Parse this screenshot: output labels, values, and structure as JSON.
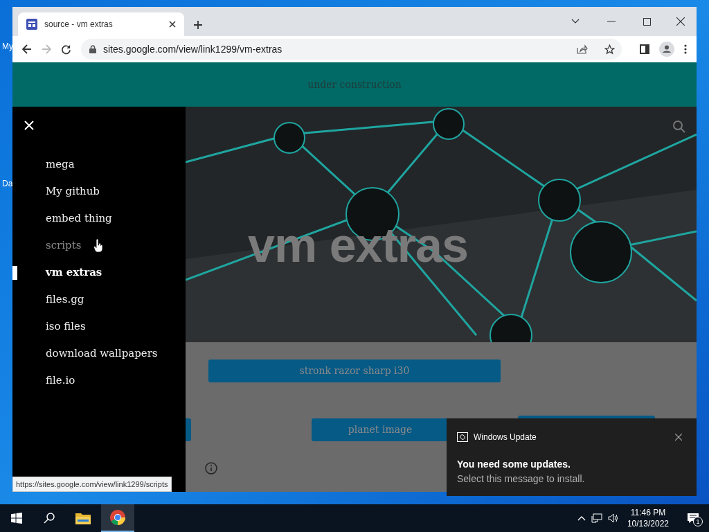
{
  "desktop_icons": [
    {
      "label": "My"
    },
    {
      "label": "Da"
    }
  ],
  "browser": {
    "tab": {
      "title": "source - vm extras",
      "selected": true
    },
    "address": "sites.google.com/view/link1299/vm-extras",
    "status_url": "https://sites.google.com/view/link1299/scripts"
  },
  "site": {
    "banner": "under construction",
    "hero_title": "vm extras",
    "nav": [
      {
        "label": "mega",
        "selected": false,
        "hovered": false
      },
      {
        "label": "My github",
        "selected": false,
        "hovered": false
      },
      {
        "label": "embed thing",
        "selected": false,
        "hovered": false
      },
      {
        "label": "scripts",
        "selected": false,
        "hovered": true
      },
      {
        "label": "vm extras",
        "selected": true,
        "hovered": false
      },
      {
        "label": "files.gg",
        "selected": false,
        "hovered": false
      },
      {
        "label": "iso files",
        "selected": false,
        "hovered": false
      },
      {
        "label": "download wallpapers",
        "selected": false,
        "hovered": false
      },
      {
        "label": "file.io",
        "selected": false,
        "hovered": false
      }
    ],
    "buttons": [
      "stronk razor sharp i30",
      "planet image"
    ]
  },
  "notification": {
    "app": "Windows Update",
    "title": "You need some updates.",
    "message": "Select this message to install."
  },
  "taskbar": {
    "time": "11:46 PM",
    "date": "10/13/2022",
    "notification_count": "1"
  }
}
